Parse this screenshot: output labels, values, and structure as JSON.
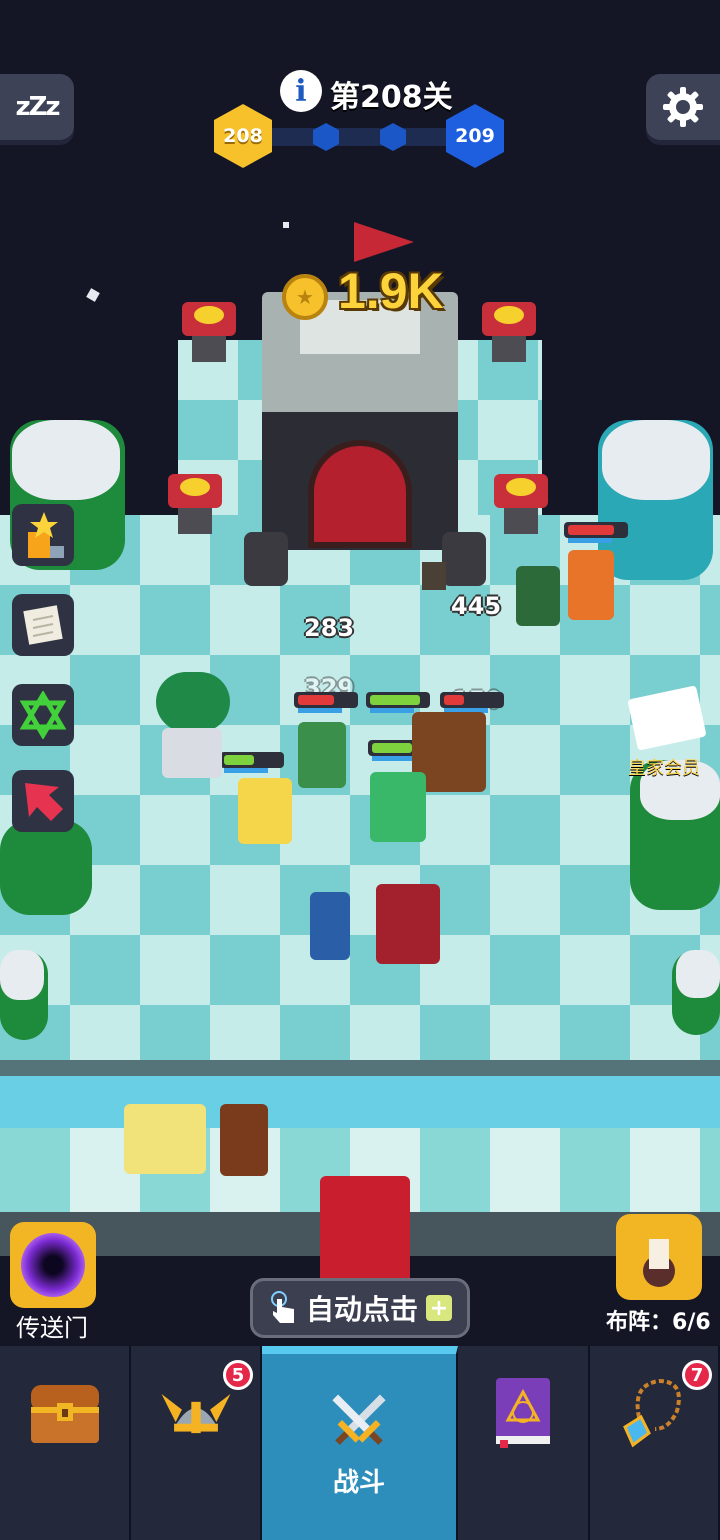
{
  "header": {
    "level_title": "第208关",
    "current_level": "208",
    "next_level": "209",
    "sleep_icon_text": "zZz"
  },
  "battle": {
    "castle_gold": "1.9K",
    "damage_numbers": [
      "283",
      "445",
      "329",
      "150"
    ]
  },
  "side_menu": {
    "royal_member_label": "皇家会员"
  },
  "controls": {
    "portal_label": "传送门",
    "auto_click_label": "自动点击",
    "formation_label": "布阵：",
    "formation_value": "6/6"
  },
  "bottom_nav": {
    "tabs": [
      {
        "name": "treasure",
        "icon": "treasure-chest-icon"
      },
      {
        "name": "heroes",
        "icon": "viking-helmet-icon",
        "badge": "5"
      },
      {
        "name": "battle",
        "icon": "crossed-swords-icon",
        "label": "战斗",
        "active": true
      },
      {
        "name": "spellbook",
        "icon": "spellbook-icon"
      },
      {
        "name": "amulet",
        "icon": "amulet-icon",
        "badge": "7"
      }
    ]
  },
  "colors": {
    "gold": "#fcd33a",
    "active_tab": "#2d8dbb",
    "badge_red": "#e5284a",
    "level_current": "#f6c12a",
    "level_next": "#1e5fe0"
  }
}
